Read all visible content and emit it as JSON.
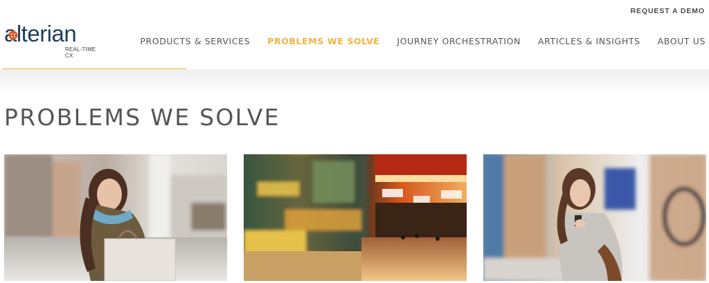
{
  "topbar": {
    "request_demo": "REQUEST A DEMO"
  },
  "logo": {
    "wordmark": "alterian",
    "tagline": "REAL-TIME CX"
  },
  "nav": [
    {
      "label": "PRODUCTS & SERVICES",
      "active": false
    },
    {
      "label": "PROBLEMS WE SOLVE",
      "active": true
    },
    {
      "label": "JOURNEY ORCHESTRATION",
      "active": false
    },
    {
      "label": "ARTICLES & INSIGHTS",
      "active": false
    },
    {
      "label": "ABOUT US",
      "active": false
    }
  ],
  "page": {
    "title": "PROBLEMS WE SOLVE"
  },
  "colors": {
    "accent": "#f0b43c",
    "brand_navy": "#1f3b5c",
    "text": "#555555"
  },
  "cards": [
    {
      "image": "woman-with-shopping-bag-photo"
    },
    {
      "image": "blurred-shopping-mall-photo"
    },
    {
      "image": "woman-looking-at-phone-in-store-photo"
    }
  ]
}
